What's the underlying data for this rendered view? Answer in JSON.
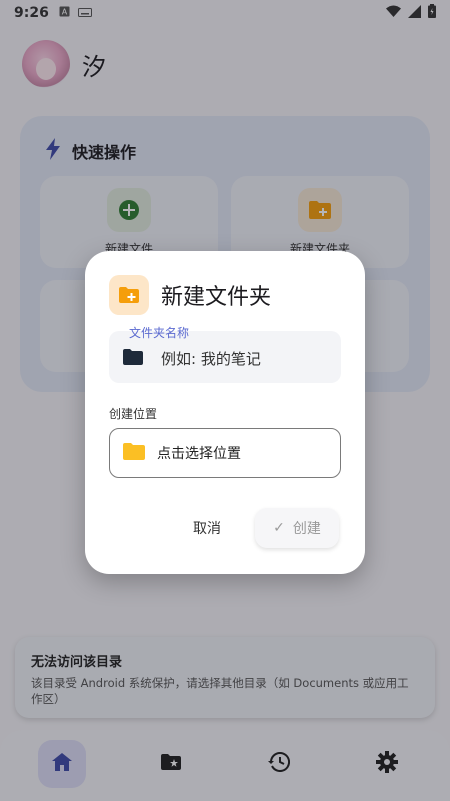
{
  "status_bar": {
    "time": "9:26",
    "icons": [
      "a-icon",
      "keyboard-icon",
      "wifi-icon",
      "signal-icon",
      "battery-icon"
    ]
  },
  "header": {
    "app_title": "汐"
  },
  "quick_actions": {
    "title": "快速操作",
    "items": [
      {
        "label": "新建文件",
        "icon": "plus-circle-icon",
        "color": "#2e7d32"
      },
      {
        "label": "新建文件夹",
        "icon": "folder-plus-icon",
        "color": "#f59e0b"
      }
    ]
  },
  "dialog": {
    "title": "新建文件夹",
    "name_field_label": "文件夹名称",
    "name_field_placeholder": "例如: 我的笔记",
    "location_label": "创建位置",
    "location_button_text": "点击选择位置",
    "cancel_label": "取消",
    "create_label": "创建",
    "create_check": "✓"
  },
  "snackbar": {
    "title": "无法访问该目录",
    "message": "该目录受 Android 系统保护，请选择其他目录（如 Documents 或应用工作区）"
  },
  "bottom_nav": {
    "items": [
      {
        "name": "home",
        "icon": "home-icon",
        "active": true
      },
      {
        "name": "favorites",
        "icon": "star-folder-icon",
        "active": false
      },
      {
        "name": "history",
        "icon": "history-icon",
        "active": false
      },
      {
        "name": "settings",
        "icon": "gear-icon",
        "active": false
      }
    ]
  },
  "colors": {
    "accent": "#3f51b5",
    "folder": "#fbbf24",
    "dialog_icon_bg": "#fde6c8",
    "floating_label": "#5b6ad0"
  }
}
